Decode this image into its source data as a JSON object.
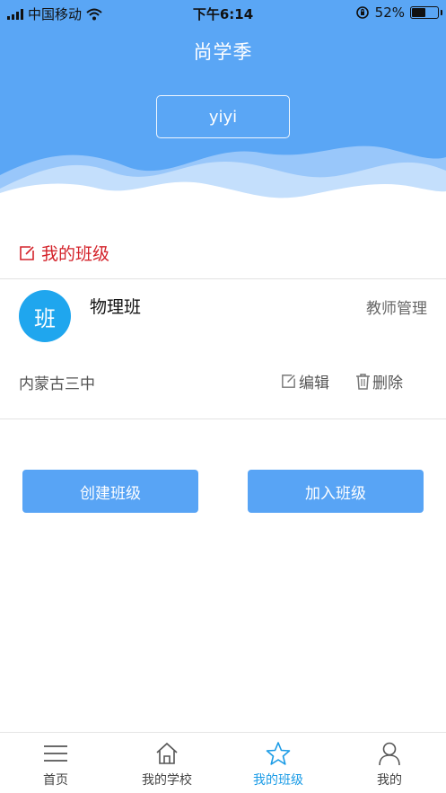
{
  "status_bar": {
    "carrier": "中国移动",
    "time": "下午6:14",
    "battery_percent": "52%",
    "battery_level": 0.52
  },
  "header": {
    "app_title": "尚学季",
    "username": "yiyi"
  },
  "section": {
    "title": "我的班级"
  },
  "class_item": {
    "avatar_text": "班",
    "name": "物理班",
    "role": "教师管理",
    "school": "内蒙古三中",
    "edit_label": "编辑",
    "delete_label": "删除"
  },
  "buttons": {
    "create_label": "创建班级",
    "join_label": "加入班级"
  },
  "tabs": [
    {
      "label": "首页",
      "icon": "menu-icon"
    },
    {
      "label": "我的学校",
      "icon": "home-icon"
    },
    {
      "label": "我的班级",
      "icon": "star-icon"
    },
    {
      "label": "我的",
      "icon": "user-icon"
    }
  ],
  "colors": {
    "header_blue": "#5aa6f5",
    "accent_red": "#d4232b",
    "avatar_blue": "#1fa6ee",
    "button_blue": "#58a4f5",
    "tab_active": "#1a9be6"
  }
}
